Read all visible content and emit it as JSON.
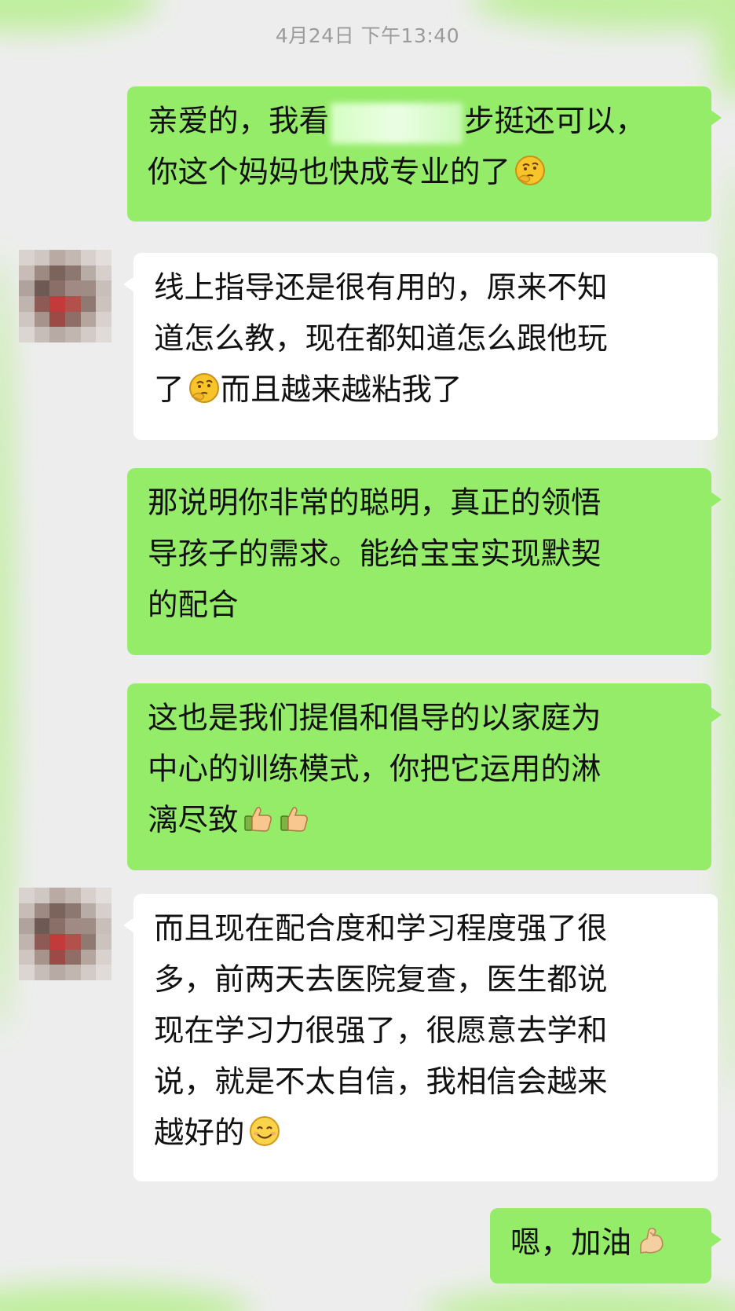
{
  "timestamp": "4月24日 下午13:40",
  "colors": {
    "background": "#ededed",
    "my_bubble": "#95ec69",
    "other_bubble": "#ffffff",
    "timestamp_text": "#9b9b9b"
  },
  "messages": [
    {
      "sender": "me",
      "line1_a": "亲爱的，我看",
      "line1_b": "步挺还可以，",
      "line2": "你这个妈妈也快成专业的了",
      "emoji": "thinking-emoji"
    },
    {
      "sender": "other",
      "line1": "线上指导还是很有用的，原来不知",
      "line2": "道怎么教，现在都知道怎么跟他玩",
      "line3_a": "了",
      "line3_emoji": "thinking-emoji",
      "line3_b": "而且越来越粘我了"
    },
    {
      "sender": "me",
      "line1": "那说明你非常的聪明，真正的领悟",
      "line2": "导孩子的需求。能给宝宝实现默契",
      "line3": "的配合"
    },
    {
      "sender": "me",
      "line1": "这也是我们提倡和倡导的以家庭为",
      "line2": "中心的训练模式，你把它运用的淋",
      "line3": "漓尽致",
      "emojis": [
        "thumbs-up-emoji",
        "thumbs-up-emoji"
      ]
    },
    {
      "sender": "other",
      "line1": "而且现在配合度和学习程度强了很",
      "line2": "多，前两天去医院复查，医生都说",
      "line3": "现在学习力很强了，很愿意去学和",
      "line4": "说，就是不太自信，我相信会越来",
      "line5": "越好的",
      "emoji": "smile-emoji"
    },
    {
      "sender": "me",
      "line1": "嗯，加油",
      "emoji": "flexed-biceps-emoji"
    }
  ]
}
